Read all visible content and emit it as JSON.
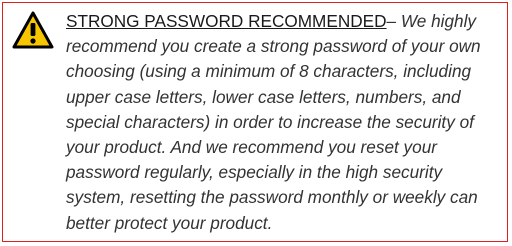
{
  "notice": {
    "icon": "warning-triangle-icon",
    "title": "STRONG PASSWORD RECOMMENDED",
    "dash": "– ",
    "body": "We highly recommend you create a strong password of your own choosing (using a minimum of 8 characters, including upper case letters, lower case letters, numbers, and special characters) in order to increase the security of your product. And we recommend you reset your password regularly, especially in the high security system, resetting the password monthly or weekly can better protect your product."
  },
  "colors": {
    "border": "#e02020",
    "icon_fill": "#f7c600",
    "icon_stroke": "#000000",
    "text": "#333333"
  }
}
